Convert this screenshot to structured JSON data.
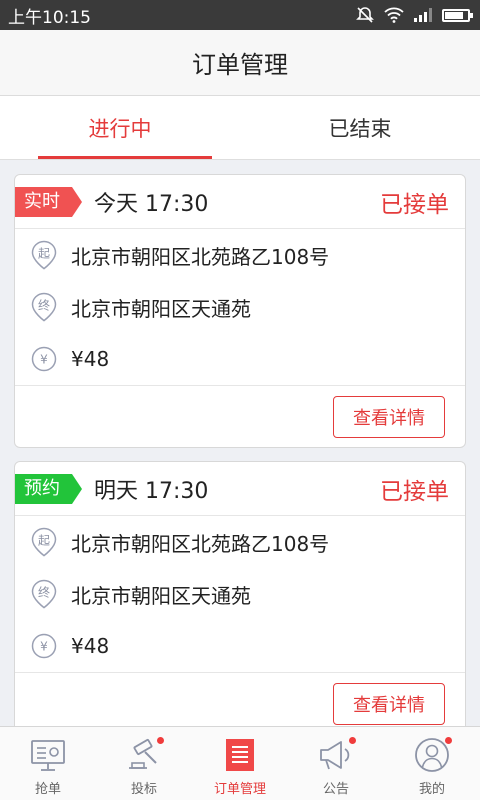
{
  "status_bar": {
    "time": "上午10:15"
  },
  "header": {
    "title": "订单管理"
  },
  "tabs": [
    {
      "label": "进行中",
      "active": true
    },
    {
      "label": "已结束",
      "active": false
    }
  ],
  "orders": [
    {
      "tag": "实时",
      "tag_color": "#f05252",
      "when": "今天 17:30",
      "status": "已接单",
      "start_icon": "起",
      "start": "北京市朝阳区北苑路乙108号",
      "end_icon": "终",
      "end": "北京市朝阳区天通苑",
      "price_icon": "¥",
      "price": "¥48",
      "button": "查看详情"
    },
    {
      "tag": "预约",
      "tag_color": "#22c43a",
      "when": "明天 17:30",
      "status": "已接单",
      "start_icon": "起",
      "start": "北京市朝阳区北苑路乙108号",
      "end_icon": "终",
      "end": "北京市朝阳区天通苑",
      "price_icon": "¥",
      "price": "¥48",
      "button": "查看详情"
    }
  ],
  "bottom_nav": [
    {
      "label": "抢单",
      "icon": "grab-order-icon",
      "active": false,
      "badge": false
    },
    {
      "label": "投标",
      "icon": "gavel-icon",
      "active": false,
      "badge": true
    },
    {
      "label": "订单管理",
      "icon": "order-list-icon",
      "active": true,
      "badge": false
    },
    {
      "label": "公告",
      "icon": "megaphone-icon",
      "active": false,
      "badge": true
    },
    {
      "label": "我的",
      "icon": "profile-icon",
      "active": false,
      "badge": true
    }
  ],
  "colors": {
    "accent": "#e43b3b",
    "realtime_tag": "#f05252",
    "scheduled_tag": "#22c43a"
  }
}
